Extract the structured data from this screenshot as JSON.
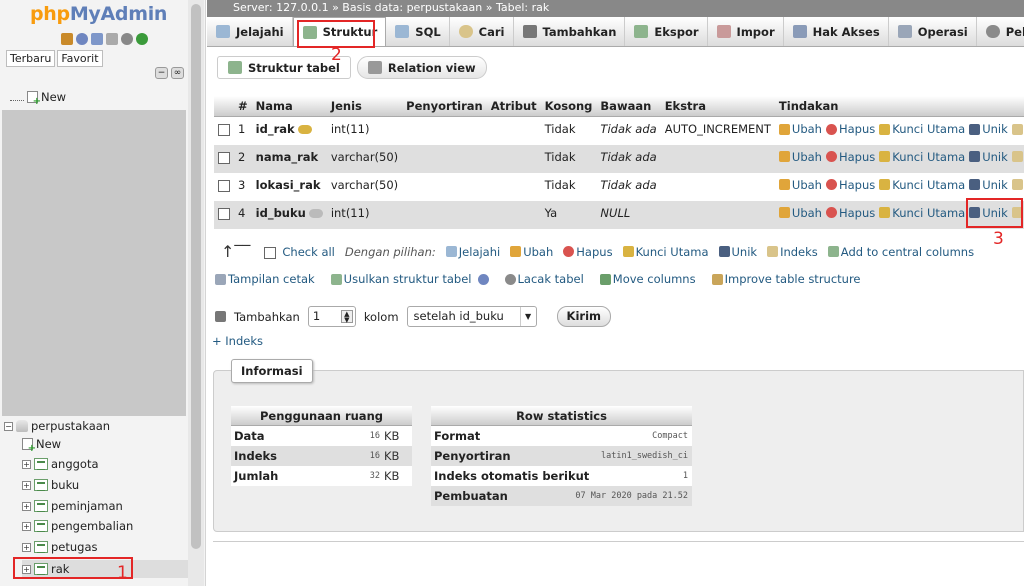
{
  "logo": {
    "part1": "php",
    "part2": "MyAdmin"
  },
  "sidebar": {
    "tabs": [
      "Terbaru",
      "Favorit"
    ],
    "new_top": "New",
    "database": "perpustakaan",
    "db_new": "New",
    "tables": [
      "anggota",
      "buku",
      "peminjaman",
      "pengembalian",
      "petugas",
      "rak"
    ]
  },
  "breadcrumb": {
    "server": "Server: 127.0.0.1",
    "sep": "»",
    "database": "Basis data: perpustakaan",
    "table": "Tabel: rak"
  },
  "tabs": [
    {
      "label": "Jelajahi",
      "icon": "browse-icon"
    },
    {
      "label": "Struktur",
      "icon": "structure-icon"
    },
    {
      "label": "SQL",
      "icon": "sql-icon"
    },
    {
      "label": "Cari",
      "icon": "search-icon"
    },
    {
      "label": "Tambahkan",
      "icon": "insert-icon"
    },
    {
      "label": "Ekspor",
      "icon": "export-icon"
    },
    {
      "label": "Impor",
      "icon": "import-icon"
    },
    {
      "label": "Hak Akses",
      "icon": "privileges-icon"
    },
    {
      "label": "Operasi",
      "icon": "operations-icon"
    },
    {
      "label": "Pelacaka",
      "icon": "tracking-icon"
    }
  ],
  "subtabs": [
    "Struktur tabel",
    "Relation view"
  ],
  "table": {
    "headers": [
      "#",
      "Nama",
      "Jenis",
      "Penyortiran",
      "Atribut",
      "Kosong",
      "Bawaan",
      "Ekstra",
      "Tindakan"
    ],
    "rows": [
      {
        "num": "1",
        "name": "id_rak",
        "type": "int(11)",
        "collation": "",
        "attr": "",
        "null": "Tidak",
        "default": "Tidak ada",
        "extra": "AUTO_INCREMENT"
      },
      {
        "num": "2",
        "name": "nama_rak",
        "type": "varchar(50)",
        "collation": "",
        "attr": "",
        "null": "Tidak",
        "default": "Tidak ada",
        "extra": ""
      },
      {
        "num": "3",
        "name": "lokasi_rak",
        "type": "varchar(50)",
        "collation": "",
        "attr": "",
        "null": "Tidak",
        "default": "Tidak ada",
        "extra": ""
      },
      {
        "num": "4",
        "name": "id_buku",
        "type": "int(11)",
        "collation": "",
        "attr": "",
        "null": "Ya",
        "default": "NULL",
        "extra": ""
      }
    ],
    "actions": [
      "Ubah",
      "Hapus",
      "Kunci Utama",
      "Unik",
      "Indeks"
    ]
  },
  "bulk": {
    "check_all": "Check all",
    "with_selected": "Dengan pilihan:",
    "actions": [
      "Jelajahi",
      "Ubah",
      "Hapus",
      "Kunci Utama",
      "Unik",
      "Indeks",
      "Add to central columns"
    ]
  },
  "links": [
    "Tampilan cetak",
    "Usulkan struktur tabel",
    "Lacak tabel",
    "Move columns",
    "Improve table structure"
  ],
  "add_column": {
    "label": "Tambahkan",
    "count": "1",
    "unit": "kolom",
    "position": "setelah id_buku",
    "submit": "Kirim"
  },
  "add_index": "+ Indeks",
  "info": {
    "legend": "Informasi",
    "space": {
      "title": "Penggunaan ruang",
      "rows": [
        {
          "k": "Data",
          "v": "16",
          "u": "KB"
        },
        {
          "k": "Indeks",
          "v": "16",
          "u": "KB"
        },
        {
          "k": "Jumlah",
          "v": "32",
          "u": "KB"
        }
      ]
    },
    "stats": {
      "title": "Row statistics",
      "rows": [
        {
          "k": "Format",
          "v": "Compact"
        },
        {
          "k": "Penyortiran",
          "v": "latin1_swedish_ci"
        },
        {
          "k": "Indeks otomatis berikut",
          "v": "1"
        },
        {
          "k": "Pembuatan",
          "v": "07 Mar 2020 pada 21.52"
        }
      ]
    }
  },
  "annotations": [
    "1",
    "2",
    "3"
  ],
  "colors": {
    "accent": "#235a81",
    "annotation": "#e32626",
    "logo_orange": "#f89c0e",
    "logo_blue": "#5f7fb8"
  }
}
